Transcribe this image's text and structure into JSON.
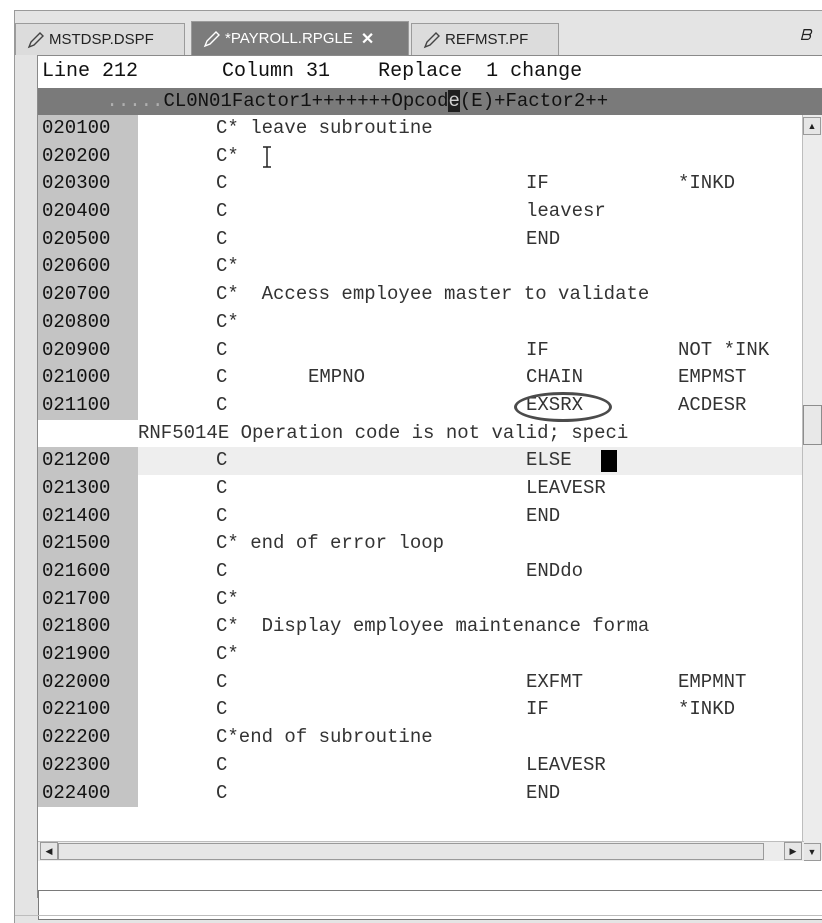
{
  "tabs": [
    {
      "label": "MSTDSP.DSPF",
      "active": false
    },
    {
      "label": "*PAYROLL.RPGLE",
      "active": true
    },
    {
      "label": "REFMST.PF",
      "active": false
    }
  ],
  "tab_close_glyph": "✕",
  "restore_glyph": "ᗷ",
  "status": {
    "line": "Line 212",
    "column": "Column 31",
    "mode": "Replace",
    "changes": "1 change"
  },
  "ruler": {
    "dots": ".....",
    "before": "CL0N01Factor1+++++++Opcod",
    "cursor_char": "e",
    "after": "(E)+Factor2++"
  },
  "lines": [
    {
      "seq": "020100",
      "c1": "C* leave subroutine",
      "c2": "",
      "c3": "",
      "c4": ""
    },
    {
      "seq": "020200",
      "c1": "C*",
      "c2": "",
      "c3": "",
      "c4": ""
    },
    {
      "seq": "020300",
      "c1": "C",
      "c2": "",
      "c3": "IF",
      "c4": "*INKD"
    },
    {
      "seq": "020400",
      "c1": "C",
      "c2": "",
      "c3": "leavesr",
      "c4": ""
    },
    {
      "seq": "020500",
      "c1": "C",
      "c2": "",
      "c3": "END",
      "c4": ""
    },
    {
      "seq": "020600",
      "c1": "C*",
      "c2": "",
      "c3": "",
      "c4": ""
    },
    {
      "seq": "020700",
      "c1": "C*  Access employee master to validate",
      "c2": "",
      "c3": "",
      "c4": ""
    },
    {
      "seq": "020800",
      "c1": "C*",
      "c2": "",
      "c3": "",
      "c4": ""
    },
    {
      "seq": "020900",
      "c1": "C",
      "c2": "",
      "c3": "IF",
      "c4": "NOT *INK"
    },
    {
      "seq": "021000",
      "c1": "C",
      "c2": "EMPNO",
      "c3": "CHAIN",
      "c4": "EMPMST"
    },
    {
      "seq": "021100",
      "c1": "C",
      "c2": "",
      "c3": "EXSRX",
      "c4": "ACDESR"
    },
    {
      "seq": "",
      "msg": "RNF5014E Operation code is not valid; speci"
    },
    {
      "seq": "021200",
      "c1": "C",
      "c2": "",
      "c3": "ELSE",
      "c4": ""
    },
    {
      "seq": "021300",
      "c1": "C",
      "c2": "",
      "c3": "LEAVESR",
      "c4": ""
    },
    {
      "seq": "021400",
      "c1": "C",
      "c2": "",
      "c3": "END",
      "c4": ""
    },
    {
      "seq": "021500",
      "c1": "C* end of error loop",
      "c2": "",
      "c3": "",
      "c4": ""
    },
    {
      "seq": "021600",
      "c1": "C",
      "c2": "",
      "c3": "ENDdo",
      "c4": ""
    },
    {
      "seq": "021700",
      "c1": "C*",
      "c2": "",
      "c3": "",
      "c4": ""
    },
    {
      "seq": "021800",
      "c1": "C*  Display employee maintenance forma",
      "c2": "",
      "c3": "",
      "c4": ""
    },
    {
      "seq": "021900",
      "c1": "C*",
      "c2": "",
      "c3": "",
      "c4": ""
    },
    {
      "seq": "022000",
      "c1": "C",
      "c2": "",
      "c3": "EXFMT",
      "c4": "EMPMNT"
    },
    {
      "seq": "022100",
      "c1": "C",
      "c2": "",
      "c3": "IF",
      "c4": "*INKD"
    },
    {
      "seq": "022200",
      "c1": "C*end of subroutine",
      "c2": "",
      "c3": "",
      "c4": ""
    },
    {
      "seq": "022300",
      "c1": "C",
      "c2": "",
      "c3": "LEAVESR",
      "c4": ""
    },
    {
      "seq": "022400",
      "c1": "C",
      "c2": "",
      "c3": "END",
      "c4": ""
    }
  ],
  "scroll": {
    "up": "▲",
    "down": "▼",
    "left": "◀",
    "right": "▶"
  }
}
